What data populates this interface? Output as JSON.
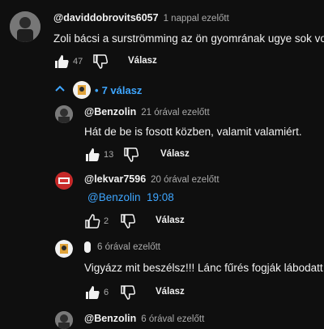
{
  "comment": {
    "author": "@daviddobrovits6057",
    "time": "1 nappal ezelőtt",
    "text": "Zoli bácsi a surströmming az ön gyomrának ugye sok vo",
    "likes": "47",
    "reply_label": "Válasz"
  },
  "replies_toggle": {
    "label": "7 válasz"
  },
  "replies": [
    {
      "author": "@Benzolin",
      "time": "21 órával ezelőtt",
      "text": "Hát de be is fosott közben, valamit valamiért.",
      "likes": "13",
      "reply_label": "Válasz"
    },
    {
      "author": "@lekvar7596",
      "time": "20 órával ezelőtt",
      "mention": "@Benzolin",
      "timestamp": "19:08",
      "likes": "2",
      "reply_label": "Válasz"
    },
    {
      "author": "",
      "time": "6 órával ezelőtt",
      "text": "Vigyázz mit beszélsz!!! Lánc fűrés fogják lábodatt",
      "likes": "6",
      "reply_label": "Válasz"
    },
    {
      "author": "@Benzolin",
      "time": "6 órával ezelőtt"
    }
  ],
  "colors": {
    "background": "#0f0f0f",
    "link": "#3ea6ff",
    "muted": "#aaaaaa"
  }
}
